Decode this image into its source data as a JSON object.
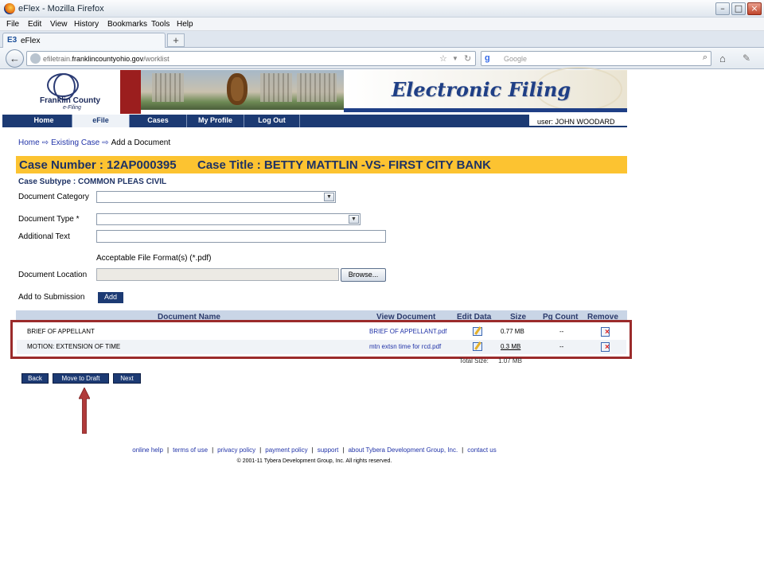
{
  "browser": {
    "window_title": "eFlex - Mozilla Firefox",
    "menu": [
      "File",
      "Edit",
      "View",
      "History",
      "Bookmarks",
      "Tools",
      "Help"
    ],
    "tab_icon": "E3",
    "tab_label": "eFlex",
    "url_prefix": "efiletrain.",
    "url_domain": "franklincountyohio.gov",
    "url_path": "/worklist",
    "search_engine": "Google",
    "search_placeholder": "Google"
  },
  "header": {
    "logo_line1": "Franklin County",
    "logo_line2": "e-Filing",
    "banner_title": "Electronic Filing"
  },
  "nav": {
    "items": [
      "Home",
      "eFile",
      "Cases",
      "My Profile",
      "Log Out"
    ],
    "active": "eFile",
    "user_label": "user: JOHN WOODARD"
  },
  "breadcrumb": {
    "home": "Home",
    "existing": "Existing Case",
    "current": "Add a Document",
    "separator": "⇨"
  },
  "case": {
    "number_label": "Case Number : 12AP000395",
    "title_label": "Case Title : BETTY MATTLIN -VS- FIRST CITY BANK",
    "subtype": "Case Subtype : COMMON PLEAS CIVIL"
  },
  "form": {
    "category_label": "Document Category",
    "category_value": "",
    "type_label": "Document Type *",
    "type_value": "",
    "additional_label": "Additional Text",
    "additional_value": "",
    "format_note": "Acceptable File Format(s) (*.pdf)",
    "location_label": "Document Location",
    "location_value": "",
    "browse_label": "Browse...",
    "add_label": "Add to Submission",
    "add_button": "Add"
  },
  "table": {
    "headers": [
      "Document Name",
      "View Document",
      "Edit Data",
      "Size",
      "Pg Count",
      "Remove"
    ],
    "rows": [
      {
        "name": "BRIEF OF APPELLANT",
        "view": "BRIEF OF APPELLANT.pdf",
        "size": "0.77 MB",
        "pages": "--"
      },
      {
        "name": "MOTION: EXTENSION OF TIME",
        "view": "mtn extsn time for rcd.pdf",
        "size": "0.3 MB",
        "pages": "--"
      }
    ],
    "total_label": "Total Size:",
    "total_value": "1.07 MB"
  },
  "actions": {
    "back": "Back",
    "draft": "Move to Draft",
    "next": "Next"
  },
  "footer": {
    "links": [
      "online help",
      "terms of use",
      "privacy policy",
      "payment policy",
      "support",
      "about Tybera Development Group, Inc.",
      "contact us"
    ],
    "copyright": "© 2001-11 Tybera Development Group, Inc. All rights reserved."
  },
  "colors": {
    "nav_blue": "#1c3a73",
    "case_bar": "#fcc331",
    "highlight": "#9b2b2b",
    "link": "#2234a8"
  }
}
